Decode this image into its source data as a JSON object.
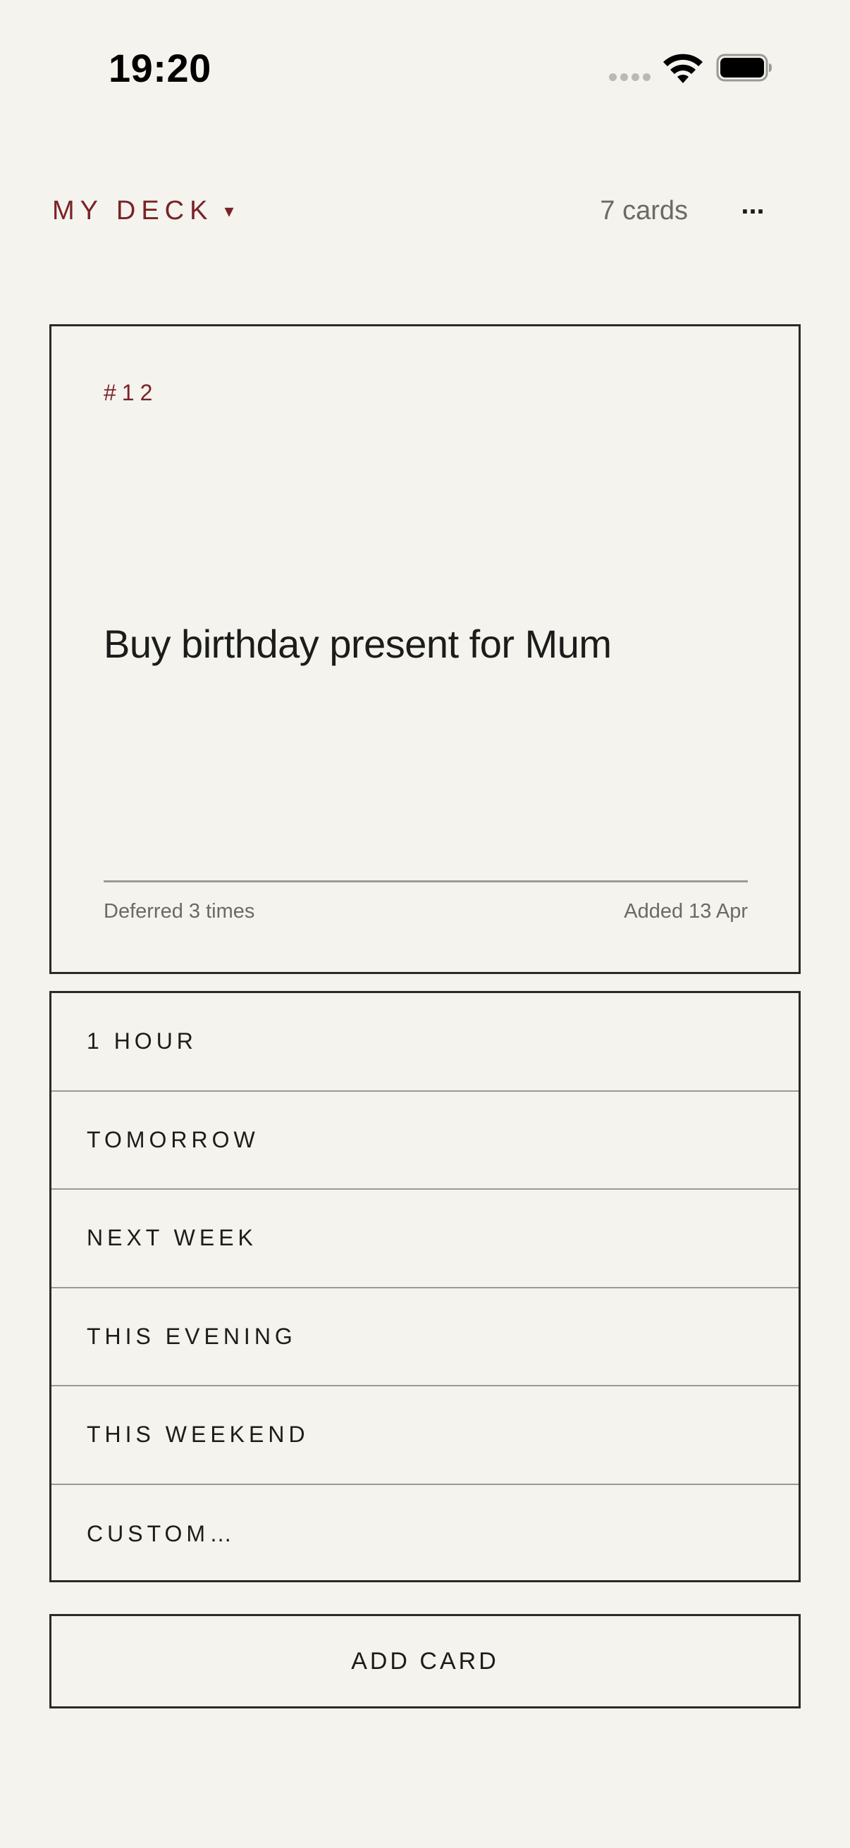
{
  "status_bar": {
    "time": "19:20",
    "icons": [
      "cellular-signal-icon",
      "wifi-icon",
      "battery-icon"
    ]
  },
  "header": {
    "deck_name": "MY DECK",
    "deck_caret": "▾",
    "card_count": "7 cards",
    "more_label": "..."
  },
  "card": {
    "number": "#12",
    "text": "Buy birthday present for Mum",
    "deferred": "Deferred 3 times",
    "added": "Added 13 Apr"
  },
  "options": [
    {
      "label": "1 HOUR"
    },
    {
      "label": "TOMORROW"
    },
    {
      "label": "NEXT WEEK"
    },
    {
      "label": "THIS EVENING"
    },
    {
      "label": "THIS WEEKEND"
    },
    {
      "label": "CUSTOM…"
    }
  ],
  "add_card_label": "ADD CARD",
  "colors": {
    "background": "#f4f3ee",
    "accent": "#7a2226",
    "border": "#2a2a28",
    "muted_text": "#6b6a66"
  }
}
